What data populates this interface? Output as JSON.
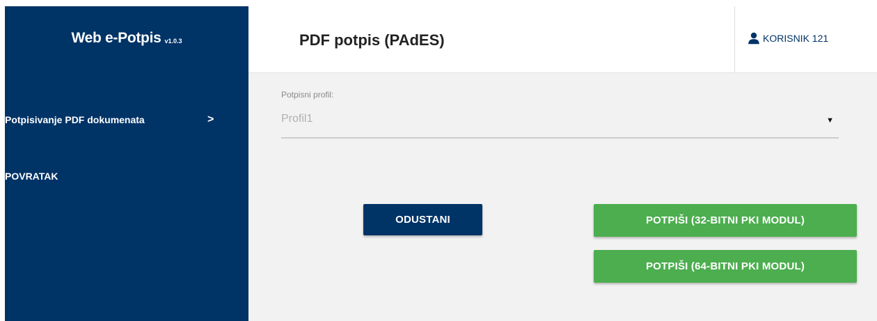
{
  "app": {
    "title": "Web e-Potpis",
    "version": "v1.0.3"
  },
  "sidebar": {
    "items": [
      {
        "label": "Potpisivanje PDF dokumenata",
        "chevron": ">"
      },
      {
        "label": "POVRATAK"
      }
    ]
  },
  "header": {
    "page_title": "PDF potpis (PAdES)",
    "user_label": "KORISNIK 121",
    "user_icon": "user-icon"
  },
  "form": {
    "profile_label": "Potpisni profil:",
    "profile_value": "Profil1",
    "dropdown_arrow": "▼"
  },
  "actions": {
    "cancel_label": "ODUSTANI",
    "sign32_label": "POTPIŠI (32-BITNI PKI MODUL)",
    "sign64_label": "POTPIŠI (64-BITNI PKI MODUL)"
  },
  "colors": {
    "sidebar_bg": "#003366",
    "primary_button": "#003366",
    "success_button": "#4cae4f",
    "content_bg": "#f2f2f2"
  }
}
